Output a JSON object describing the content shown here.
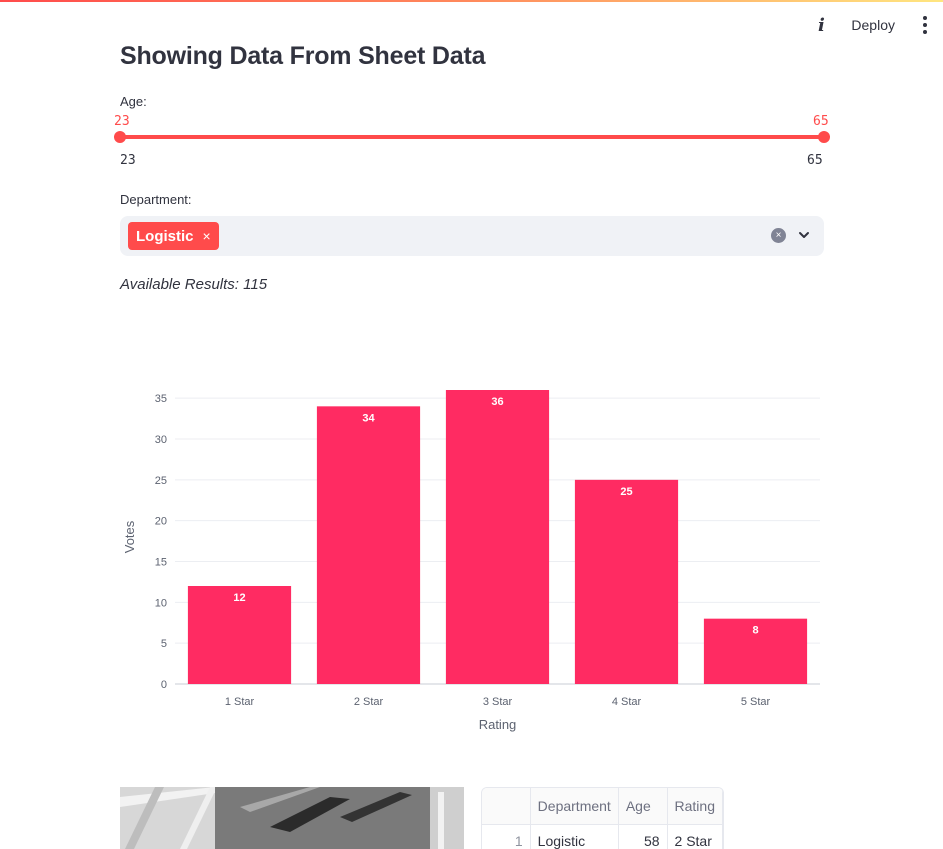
{
  "toolbar": {
    "info_icon": "info-icon",
    "deploy_label": "Deploy",
    "menu_icon": "kebab-menu-icon"
  },
  "title": "Showing Data From Sheet Data",
  "age_filter": {
    "label": "Age:",
    "low": "23",
    "high": "65",
    "min": "23",
    "max": "65"
  },
  "department_filter": {
    "label": "Department:",
    "selected": [
      "Logistic"
    ],
    "chip_remove": "×",
    "clear": "×"
  },
  "results_text": "Available Results: 115",
  "colors": {
    "accent": "#ff4b4b",
    "bar": "#ff2b62",
    "text": "#31333f"
  },
  "chart_data": {
    "type": "bar",
    "categories": [
      "1 Star",
      "2 Star",
      "3 Star",
      "4 Star",
      "5 Star"
    ],
    "values": [
      12,
      34,
      36,
      25,
      8
    ],
    "title": "",
    "xlabel": "Rating",
    "ylabel": "Votes",
    "ylim": [
      0,
      36
    ],
    "yticks": [
      0,
      5,
      10,
      15,
      20,
      25,
      30,
      35
    ],
    "grid": true,
    "data_labels": true
  },
  "image": {
    "description_icon": "building-photo"
  },
  "table": {
    "columns": [
      "",
      "Department",
      "Age",
      "Rating"
    ],
    "rows": [
      [
        "1",
        "Logistic",
        "58",
        "2 Star"
      ]
    ]
  }
}
